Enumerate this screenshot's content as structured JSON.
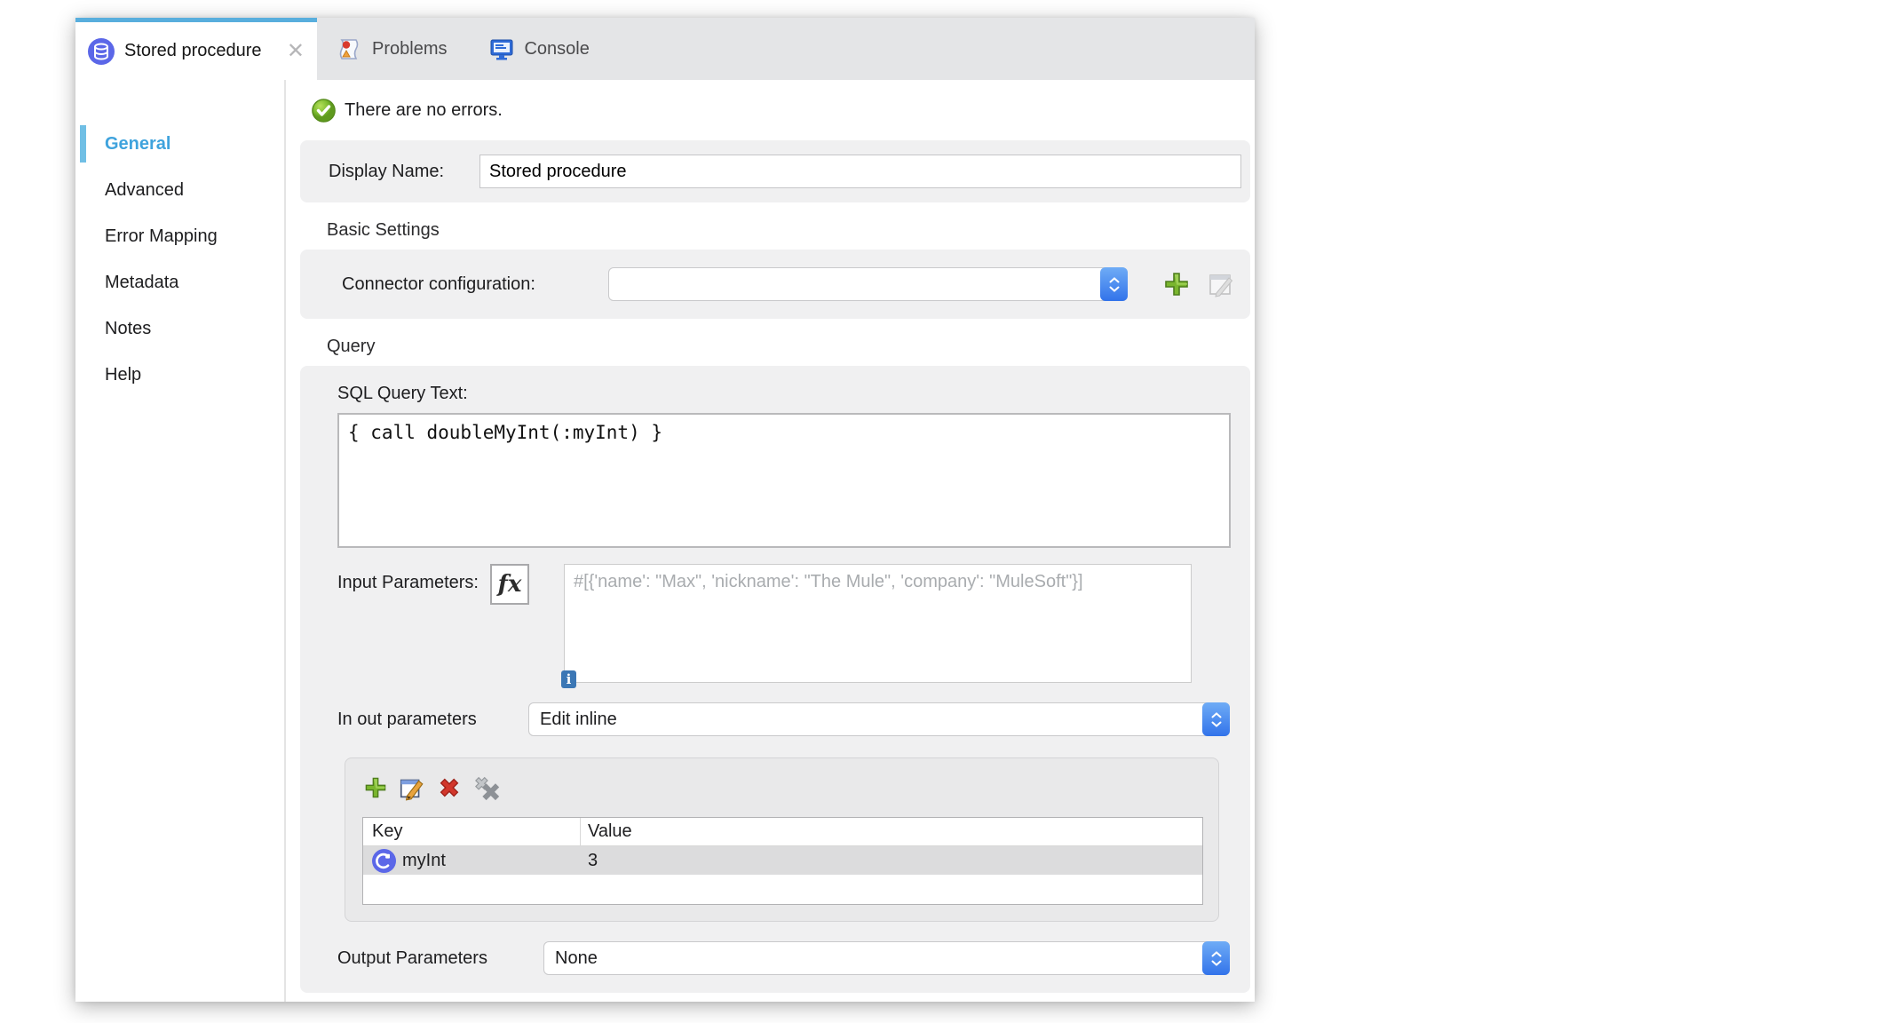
{
  "colors": {
    "tab_stripe_blue": "#58aedd",
    "sidebar_selected_blue": "#3fa3dd",
    "mule_icon_indigo": "#5b67e8",
    "success_green": "#7cbb2f",
    "combo_spinner_blue": "#3273ea",
    "panel_gray": "#f0f0f1"
  },
  "tabs": {
    "stored_procedure": {
      "label": "Stored procedure",
      "icon": "database-icon",
      "close": "✕"
    },
    "problems": {
      "label": "Problems",
      "icon": "problems-icon"
    },
    "console": {
      "label": "Console",
      "icon": "console-icon"
    }
  },
  "status": {
    "message": "There are no errors.",
    "icon": "success-check-icon"
  },
  "sidebar": {
    "selected": "General",
    "items": [
      {
        "label": "General"
      },
      {
        "label": "Advanced"
      },
      {
        "label": "Error Mapping"
      },
      {
        "label": "Metadata"
      },
      {
        "label": "Notes"
      },
      {
        "label": "Help"
      }
    ]
  },
  "general_tab": {
    "display_name": {
      "label": "Display Name:",
      "value": "Stored procedure"
    },
    "basic_settings": {
      "title": "Basic Settings",
      "connector_configuration": {
        "label": "Connector configuration:",
        "value": ""
      }
    },
    "query": {
      "title": "Query",
      "sql_query": {
        "label": "SQL Query Text:",
        "value": "{ call doubleMyInt(:myInt) }"
      },
      "input_parameters": {
        "label": "Input Parameters:",
        "fx_button": "fx",
        "value": "",
        "placeholder": "#[{'name': \"Max\", 'nickname': \"The Mule\", 'company': \"MuleSoft\"}]",
        "info_badge": "i"
      },
      "inout_parameters": {
        "label": "In out parameters",
        "value": "Edit inline"
      },
      "inout_table": {
        "columns": [
          "Key",
          "Value"
        ],
        "rows": [
          {
            "key": "myInt",
            "value": "3"
          }
        ]
      },
      "output_parameters": {
        "label": "Output Parameters",
        "value": "None"
      }
    }
  }
}
